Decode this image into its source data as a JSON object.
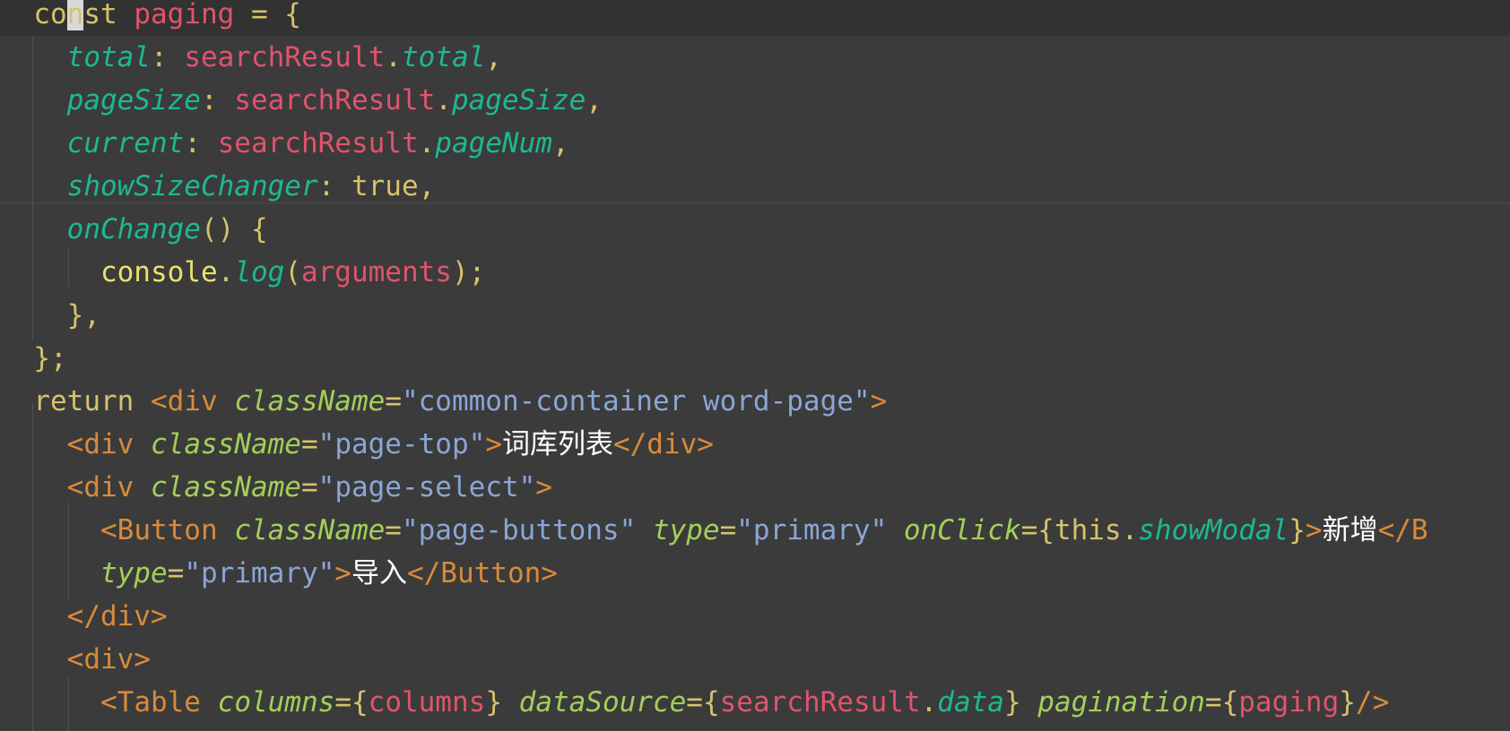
{
  "editor": {
    "lines": [
      [
        "co",
        "n",
        "st",
        " ",
        "paging",
        " = {"
      ],
      [
        "total",
        ": ",
        "searchResult",
        ".",
        "total",
        ","
      ],
      [
        "pageSize",
        ": ",
        "searchResult",
        ".",
        "pageSize",
        ","
      ],
      [
        "current",
        ": ",
        "searchResult",
        ".",
        "pageNum",
        ","
      ],
      [
        "showSizeChanger",
        ": ",
        "true",
        ","
      ],
      [
        "onChange",
        "() {"
      ],
      [
        "console",
        ".",
        "log",
        "(",
        "arguments",
        ");"
      ],
      [
        "},"
      ],
      [
        "};"
      ],
      [
        "return",
        " ",
        "<",
        "div",
        " ",
        "className",
        "=",
        "\"common-container word-page\"",
        ">"
      ],
      [
        "<",
        "div",
        " ",
        "className",
        "=",
        "\"page-top\"",
        ">",
        "词库列表",
        "</",
        "div",
        ">"
      ],
      [
        "<",
        "div",
        " ",
        "className",
        "=",
        "\"page-select\"",
        ">"
      ],
      [
        "<",
        "Button",
        " ",
        "className",
        "=",
        "\"page-buttons\"",
        " ",
        "type",
        "=",
        "\"primary\"",
        " ",
        "onClick",
        "=",
        "{",
        "this",
        ".",
        "showModal",
        "}",
        ">",
        "新增",
        "</B"
      ],
      [
        "type",
        "=",
        "\"primary\"",
        ">",
        "导入",
        "</",
        "Button",
        ">"
      ],
      [
        "</",
        "div",
        ">"
      ],
      [
        "<",
        "div",
        ">"
      ],
      [
        "<",
        "Table",
        " ",
        "columns",
        "=",
        "{",
        "columns",
        "}",
        " ",
        "dataSource",
        "=",
        "{",
        "searchResult",
        ".",
        "data",
        "}",
        " ",
        "pagination",
        "=",
        "{",
        "paging",
        "}",
        "/>"
      ]
    ]
  }
}
